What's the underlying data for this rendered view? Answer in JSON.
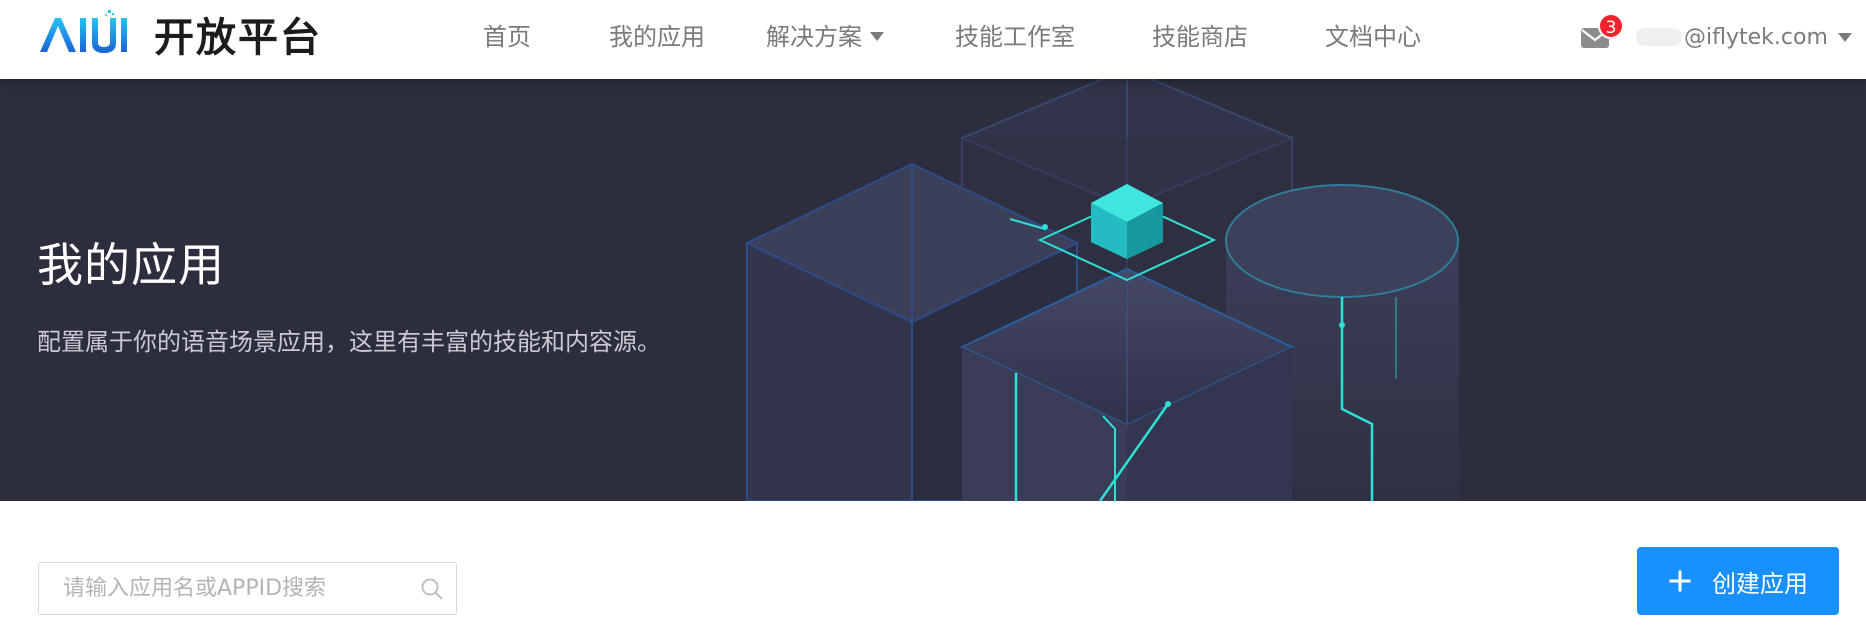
{
  "header": {
    "logo": {
      "mark": "AIUI",
      "text": "开放平台"
    },
    "nav": [
      {
        "label": "首页"
      },
      {
        "label": "我的应用"
      },
      {
        "label": "解决方案",
        "has_dropdown": true
      },
      {
        "label": "技能工作室"
      },
      {
        "label": "技能商店"
      },
      {
        "label": "文档中心"
      }
    ],
    "mail": {
      "icon": "mail-icon",
      "badge_count": "3"
    },
    "user": {
      "email": "@iflytek.com",
      "dropdown_icon": "caret-down-icon"
    }
  },
  "hero": {
    "title": "我的应用",
    "description": "配置属于你的语音场景应用，这里有丰富的技能和内容源。"
  },
  "toolbar": {
    "search_placeholder": "请输入应用名或APPID搜索",
    "search_value": "",
    "search_icon": "search-icon",
    "create_label": "创建应用",
    "create_icon": "plus-icon"
  },
  "colors": {
    "primary": "#1890ff",
    "hero_bg": "#2c2e3d",
    "accent_cyan": "#2ce0d6",
    "badge": "#f5222d",
    "nav_text": "#7a7a7a"
  }
}
